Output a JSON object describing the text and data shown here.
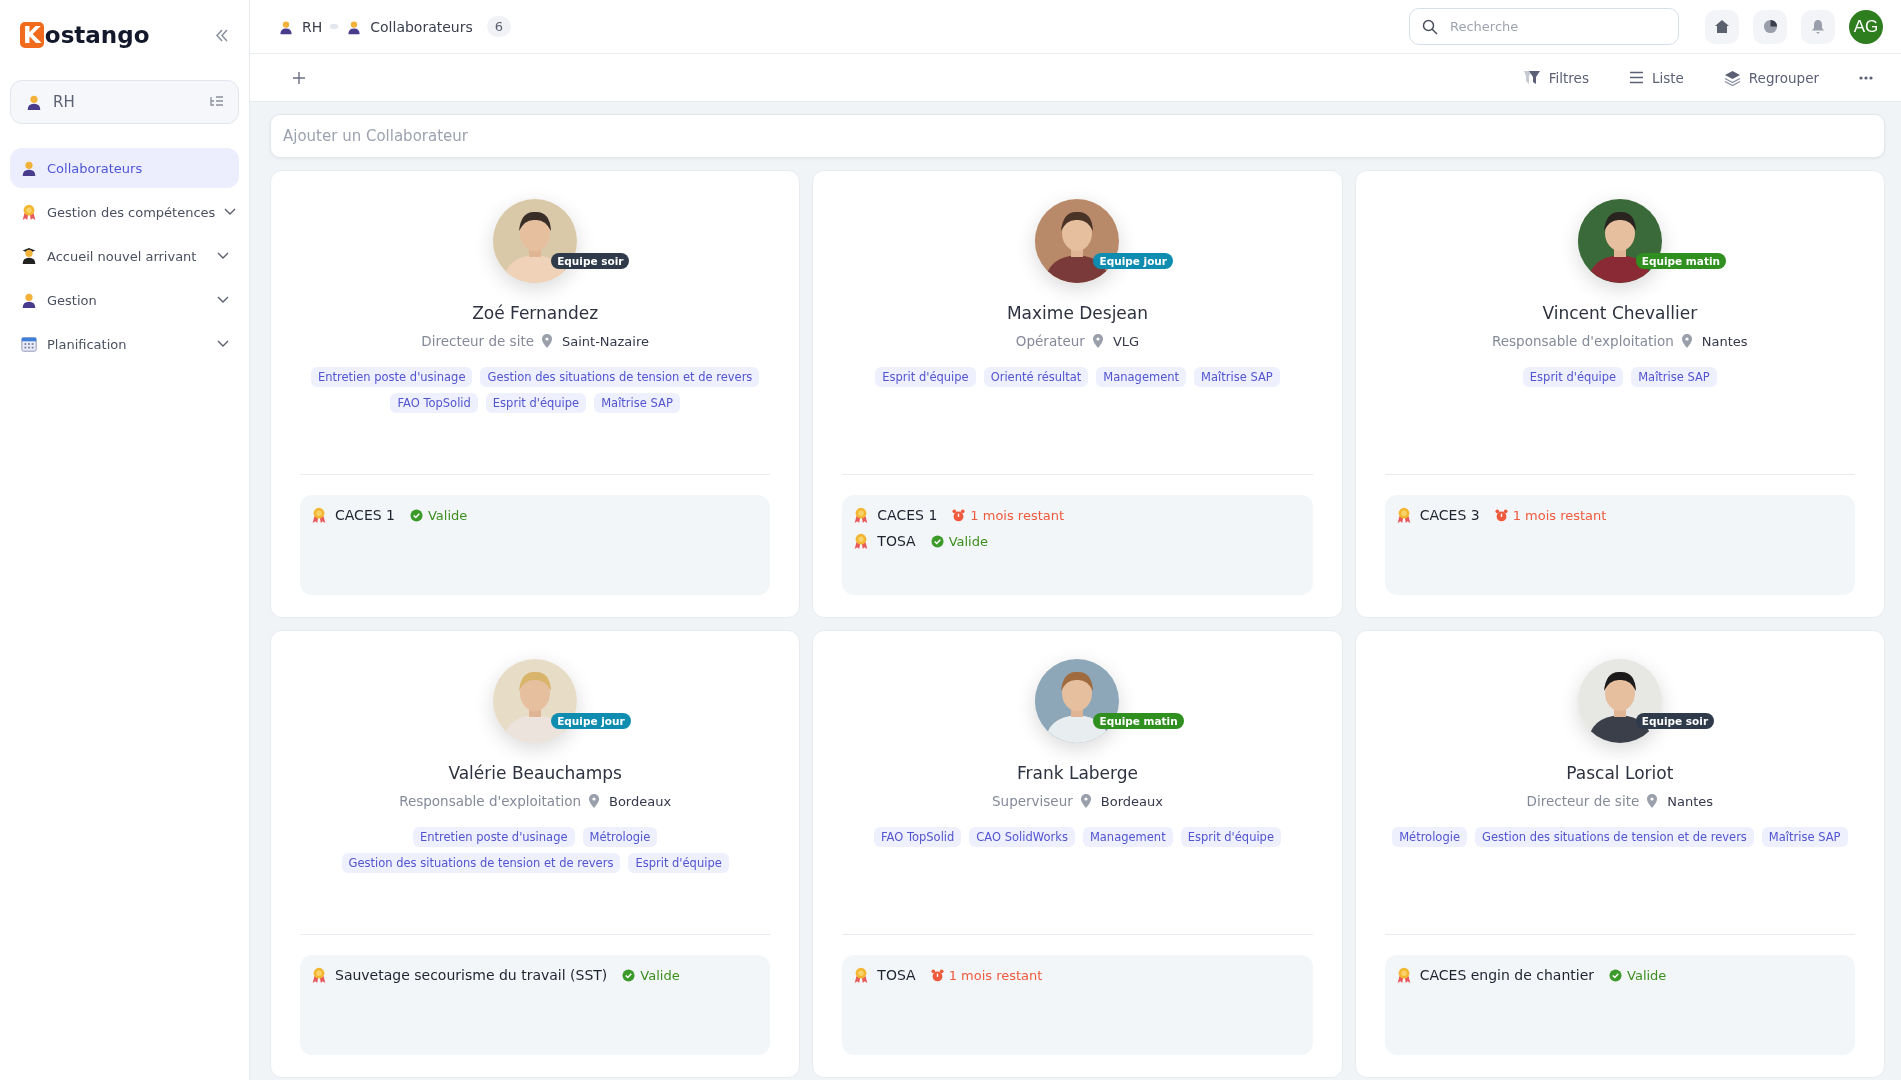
{
  "sidebar": {
    "logo_letter": "K",
    "logo_rest": "ostango",
    "workspace": "RH",
    "items": [
      {
        "label": "Collaborateurs",
        "selected": true,
        "kind": "link"
      },
      {
        "label": "Gestion des compétences",
        "selected": false,
        "kind": "group"
      },
      {
        "label": "Accueil nouvel arrivant",
        "selected": false,
        "kind": "group"
      },
      {
        "label": "Gestion",
        "selected": false,
        "kind": "group"
      },
      {
        "label": "Planification",
        "selected": false,
        "kind": "group"
      }
    ]
  },
  "breadcrumb": [
    {
      "label": "RH"
    },
    {
      "label": "Collaborateurs"
    }
  ],
  "count": "6",
  "search": {
    "placeholder": "Recherche"
  },
  "user_initials": "AG",
  "toolbar": [
    "Filtres",
    "Liste",
    "Regrouper"
  ],
  "add_field": {
    "placeholder": "Ajouter un Collaborateur"
  },
  "cards": [
    {
      "name": "Zoé Fernandez",
      "role": "Directeur de site",
      "location": "Saint-Nazaire",
      "team": {
        "label": "Equipe soir",
        "color": "#2f3a4b"
      },
      "skills": [
        "Entretien poste d'usinage",
        "Gestion des situations de tension et de revers",
        "FAO TopSolid",
        "Esprit d'équipe",
        "Maîtrise SAP"
      ],
      "certifications": [
        {
          "name": "CACES 1",
          "status": "Valide",
          "kind": "valid"
        }
      ]
    },
    {
      "name": "Maxime Desjean",
      "role": "Opérateur",
      "location": "VLG",
      "team": {
        "label": "Equipe jour",
        "color": "#0e8db0"
      },
      "skills": [
        "Esprit d'équipe",
        "Orienté résultat",
        "Management",
        "Maîtrise SAP"
      ],
      "certifications": [
        {
          "name": "CACES 1",
          "status": "1 mois restant",
          "kind": "expiring"
        },
        {
          "name": "TOSA",
          "status": "Valide",
          "kind": "valid"
        }
      ]
    },
    {
      "name": "Vincent Chevallier",
      "role": "Responsable d'exploitation",
      "location": "Nantes",
      "team": {
        "label": "Equipe matin",
        "color": "#2f8f1f"
      },
      "skills": [
        "Esprit d'équipe",
        "Maîtrise SAP"
      ],
      "certifications": [
        {
          "name": "CACES 3",
          "status": "1 mois restant",
          "kind": "expiring"
        }
      ]
    },
    {
      "name": "Valérie Beauchamps",
      "role": "Responsable d'exploitation",
      "location": "Bordeaux",
      "team": {
        "label": "Equipe jour",
        "color": "#0e8db0"
      },
      "skills": [
        "Entretien poste d'usinage",
        "Métrologie",
        "Gestion des situations de tension et de revers",
        "Esprit d'équipe"
      ],
      "certifications": [
        {
          "name": "Sauvetage secourisme du travail (SST)",
          "status": "Valide",
          "kind": "valid"
        }
      ]
    },
    {
      "name": "Frank Laberge",
      "role": "Superviseur",
      "location": "Bordeaux",
      "team": {
        "label": "Equipe matin",
        "color": "#2f8f1f"
      },
      "skills": [
        "FAO TopSolid",
        "CAO SolidWorks",
        "Management",
        "Esprit d'équipe"
      ],
      "certifications": [
        {
          "name": "TOSA",
          "status": "1 mois restant",
          "kind": "expiring"
        }
      ]
    },
    {
      "name": "Pascal Loriot",
      "role": "Directeur de site",
      "location": "Nantes",
      "team": {
        "label": "Equipe soir",
        "color": "#2f3a4b"
      },
      "skills": [
        "Métrologie",
        "Gestion des situations de tension et de revers",
        "Maîtrise SAP"
      ],
      "certifications": [
        {
          "name": "CACES engin de chantier",
          "status": "Valide",
          "kind": "valid"
        }
      ]
    }
  ]
}
